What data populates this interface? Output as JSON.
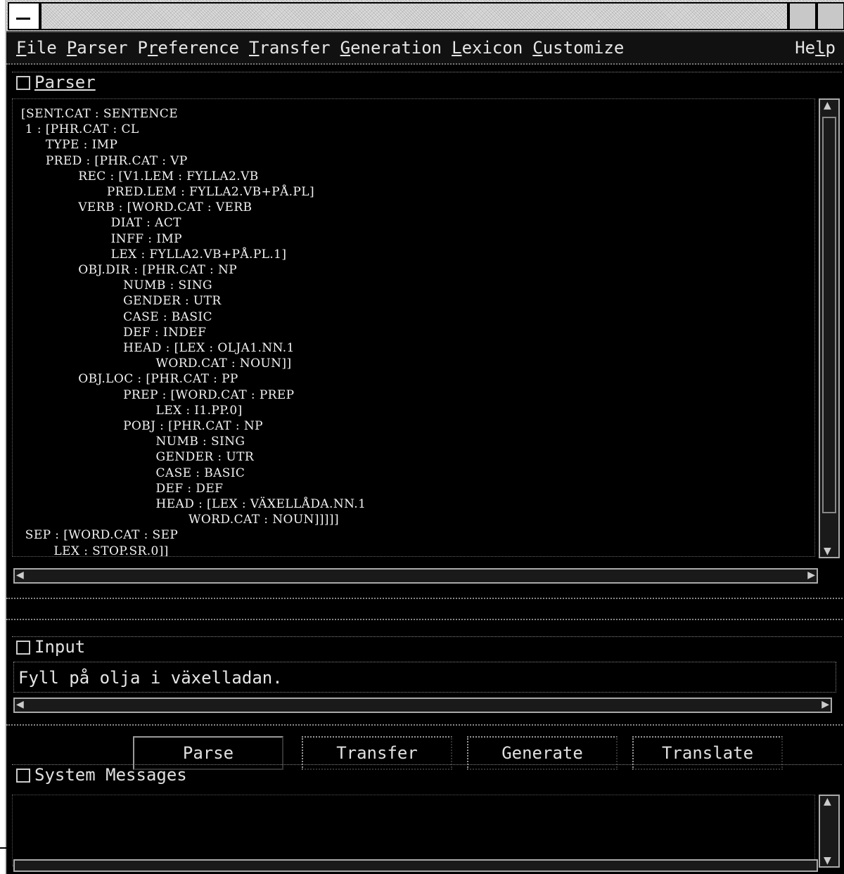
{
  "menubar": {
    "items": [
      {
        "label": "File",
        "mnemonic": "F",
        "rest": "ile"
      },
      {
        "label": "Parser",
        "mnemonic": "P",
        "rest": "arser"
      },
      {
        "label": "Preference",
        "pre": "P",
        "mnemonic": "r",
        "rest": "eference"
      },
      {
        "label": "Transfer",
        "mnemonic": "T",
        "rest": "ransfer"
      },
      {
        "label": "Generation",
        "mnemonic": "G",
        "rest": "eneration"
      },
      {
        "label": "Lexicon",
        "mnemonic": "L",
        "rest": "exicon"
      },
      {
        "label": "Customize",
        "mnemonic": "C",
        "rest": "ustomize"
      }
    ],
    "help": {
      "label": "Help",
      "pre": "He",
      "mnemonic": "l",
      "rest": "p"
    }
  },
  "parser": {
    "title": "Parser",
    "output_lines": [
      "[SENT.CAT : SENTENCE",
      " 1 : [PHR.CAT : CL",
      "      TYPE : IMP",
      "      PRED : [PHR.CAT : VP",
      "              REC : [V1.LEM : FYLLA2.VB",
      "                     PRED.LEM : FYLLA2.VB+PÅ.PL]",
      "              VERB : [WORD.CAT : VERB",
      "                      DIAT : ACT",
      "                      INFF : IMP",
      "                      LEX : FYLLA2.VB+PÅ.PL.1]",
      "              OBJ.DIR : [PHR.CAT : NP",
      "                         NUMB : SING",
      "                         GENDER : UTR",
      "                         CASE : BASIC",
      "                         DEF : INDEF",
      "                         HEAD : [LEX : OLJA1.NN.1",
      "                                 WORD.CAT : NOUN]]",
      "              OBJ.LOC : [PHR.CAT : PP",
      "                         PREP : [WORD.CAT : PREP",
      "                                 LEX : I1.PP.0]",
      "                         POBJ : [PHR.CAT : NP",
      "                                 NUMB : SING",
      "                                 GENDER : UTR",
      "                                 CASE : BASIC",
      "                                 DEF : DEF",
      "                                 HEAD : [LEX : VÄXELLÅDA.NN.1",
      "                                         WORD.CAT : NOUN]]]]]",
      " SEP : [WORD.CAT : SEP",
      "        LEX : STOP.SR.0]]"
    ]
  },
  "input": {
    "title": "Input",
    "value": "Fyll på olja i växelladan."
  },
  "buttons": {
    "parse": "Parse",
    "transfer": "Transfer",
    "generate": "Generate",
    "translate": "Translate"
  },
  "system_messages": {
    "title": "System Messages"
  },
  "icons": {
    "system_menu": "window-menu-icon",
    "scroll_up": "arrow-up-icon",
    "scroll_down": "arrow-down-icon",
    "scroll_left": "arrow-left-icon",
    "scroll_right": "arrow-right-icon"
  }
}
